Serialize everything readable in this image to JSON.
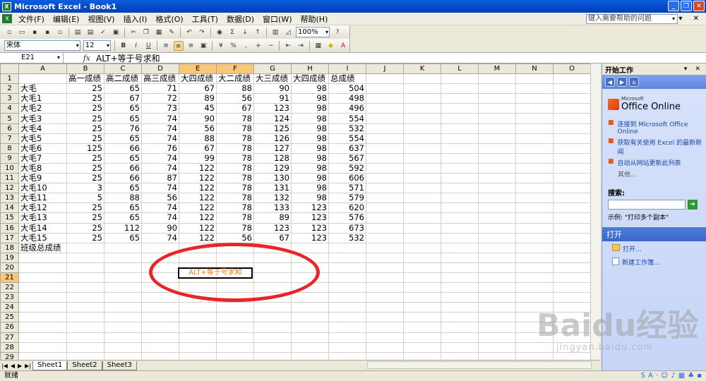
{
  "window": {
    "title": "Microsoft Excel - Book1",
    "controls": [
      "_",
      "❐",
      "✕"
    ]
  },
  "menubar": {
    "items": [
      "文件(F)",
      "编辑(E)",
      "视图(V)",
      "插入(I)",
      "格式(O)",
      "工具(T)",
      "数据(D)",
      "窗口(W)",
      "帮助(H)"
    ],
    "help_placeholder": "键入需要帮助的问题"
  },
  "toolbar": {
    "zoom": "100%",
    "font": "宋体",
    "font_size": "12"
  },
  "formula": {
    "cell_ref": "E21",
    "fx": "fx",
    "content": "ALT+等于号求和"
  },
  "grid": {
    "columns": [
      "A",
      "B",
      "C",
      "D",
      "E",
      "F",
      "G",
      "H",
      "I",
      "J",
      "K",
      "L",
      "M",
      "N",
      "O"
    ],
    "selected_columns": [
      "E",
      "F"
    ],
    "rows": [
      [
        "",
        "高一成绩",
        "高二成绩",
        "高三成绩",
        "大四成绩",
        "大二成绩",
        "大三成绩",
        "大四成绩",
        "总成绩"
      ],
      [
        "大毛",
        "25",
        "65",
        "71",
        "67",
        "88",
        "90",
        "98",
        "504"
      ],
      [
        "大毛1",
        "25",
        "67",
        "72",
        "89",
        "56",
        "91",
        "98",
        "498"
      ],
      [
        "大毛2",
        "25",
        "65",
        "73",
        "45",
        "67",
        "123",
        "98",
        "496"
      ],
      [
        "大毛3",
        "25",
        "65",
        "74",
        "90",
        "78",
        "124",
        "98",
        "554"
      ],
      [
        "大毛4",
        "25",
        "76",
        "74",
        "56",
        "78",
        "125",
        "98",
        "532"
      ],
      [
        "大毛5",
        "25",
        "65",
        "74",
        "88",
        "78",
        "126",
        "98",
        "554"
      ],
      [
        "大毛6",
        "125",
        "66",
        "76",
        "67",
        "78",
        "127",
        "98",
        "637"
      ],
      [
        "大毛7",
        "25",
        "65",
        "74",
        "99",
        "78",
        "128",
        "98",
        "567"
      ],
      [
        "大毛8",
        "25",
        "66",
        "74",
        "122",
        "78",
        "129",
        "98",
        "592"
      ],
      [
        "大毛9",
        "25",
        "66",
        "87",
        "122",
        "78",
        "130",
        "98",
        "606"
      ],
      [
        "大毛10",
        "3",
        "65",
        "74",
        "122",
        "78",
        "131",
        "98",
        "571"
      ],
      [
        "大毛11",
        "5",
        "88",
        "56",
        "122",
        "78",
        "132",
        "98",
        "579"
      ],
      [
        "大毛12",
        "25",
        "65",
        "74",
        "122",
        "78",
        "133",
        "123",
        "620"
      ],
      [
        "大毛13",
        "25",
        "65",
        "74",
        "122",
        "78",
        "89",
        "123",
        "576"
      ],
      [
        "大毛14",
        "25",
        "112",
        "90",
        "122",
        "78",
        "123",
        "123",
        "673"
      ],
      [
        "大毛15",
        "25",
        "65",
        "74",
        "122",
        "56",
        "67",
        "123",
        "532"
      ],
      [
        "班级总成绩",
        "",
        "",
        "",
        "",
        "",
        "",
        "",
        ""
      ]
    ],
    "total_rows": 29,
    "active_cell_text": "ALT+等于号求和"
  },
  "sheet_tabs": [
    "Sheet1",
    "Sheet2",
    "Sheet3"
  ],
  "status": {
    "text": "就绪"
  },
  "task_pane": {
    "title": "开始工作",
    "logo_small": "Microsoft",
    "logo_big": "Office Online",
    "links": [
      "连接到 Microsoft Office Online",
      "获取有关使用 Excel 的最新新闻",
      "自动从网站更新此列表"
    ],
    "more": "其他...",
    "search_label": "搜索:",
    "example": "示例: \"打印多个副本\"",
    "open_section": "打开",
    "open_item": "打开...",
    "new_item": "新建工作簿..."
  },
  "watermark": {
    "brand": "Baidu经验",
    "url": "jingyan.baidu.com"
  },
  "colors": {
    "title_bar": "#0548c8",
    "ring": "#e8262a",
    "active_text": "#f07a13",
    "selected_header": "#f9c778"
  }
}
